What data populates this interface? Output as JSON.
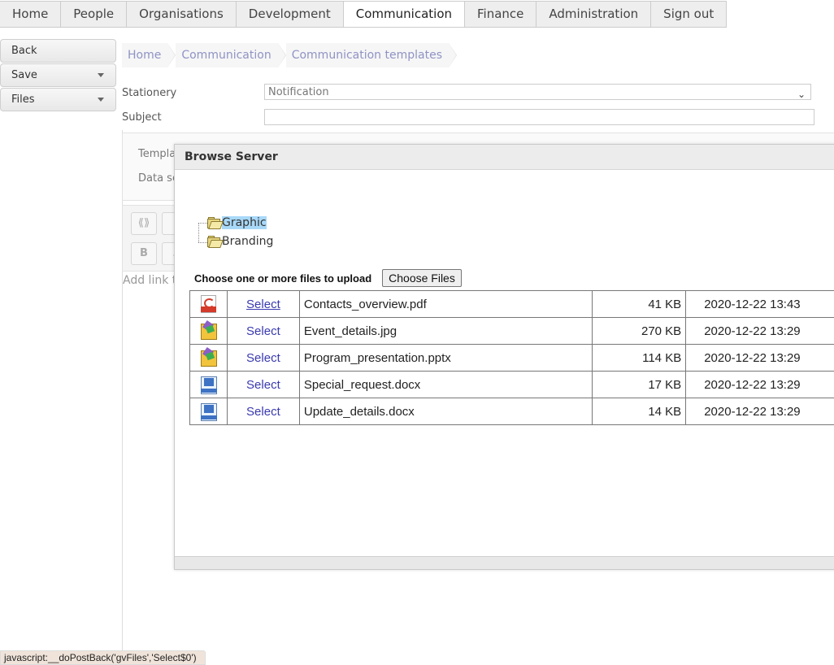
{
  "nav": {
    "items": [
      "Home",
      "People",
      "Organisations",
      "Development",
      "Communication",
      "Finance",
      "Administration",
      "Sign out"
    ],
    "active": "Communication"
  },
  "sidebar": {
    "back": "Back",
    "save": "Save",
    "files": "Files"
  },
  "breadcrumb": [
    "Home",
    "Communication",
    "Communication templates"
  ],
  "form": {
    "stationery_label": "Stationery",
    "stationery_value": "Notification",
    "subject_label": "Subject",
    "subject_value": ""
  },
  "background_panel": {
    "template_label": "Templa",
    "datasource_label": "Data sc",
    "toolbar_button_1": "⟪⟫",
    "bold": "B",
    "italic": "I",
    "add_link_text": "Add link t"
  },
  "dialog": {
    "title": "Browse Server",
    "tree": [
      {
        "label": "Graphic",
        "selected": true
      },
      {
        "label": "Branding",
        "selected": false
      }
    ],
    "upload_label": "Choose one or more files to upload",
    "choose_button": "Choose Files",
    "files": [
      {
        "icon": "pdf-icon",
        "select": "Select",
        "name": "Contacts_overview.pdf",
        "size": "41 KB",
        "date": "2020-12-22 13:43"
      },
      {
        "icon": "image-icon",
        "select": "Select",
        "name": "Event_details.jpg",
        "size": "270 KB",
        "date": "2020-12-22 13:29"
      },
      {
        "icon": "image-icon",
        "select": "Select",
        "name": "Program_presentation.pptx",
        "size": "114 KB",
        "date": "2020-12-22 13:29"
      },
      {
        "icon": "word-doc-icon",
        "select": "Select",
        "name": "Special_request.docx",
        "size": "17 KB",
        "date": "2020-12-22 13:29"
      },
      {
        "icon": "word-doc-icon",
        "select": "Select",
        "name": "Update_details.docx",
        "size": "14 KB",
        "date": "2020-12-22 13:29"
      }
    ]
  },
  "status_bar": "javascript:__doPostBack('gvFiles','Select$0')"
}
